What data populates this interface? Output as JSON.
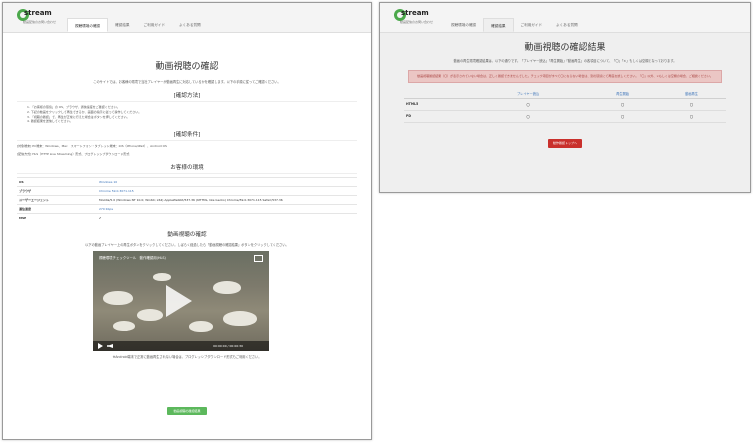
{
  "brand": {
    "logo_text": "stream",
    "logo_sub": "動画配信のお問い合わせ"
  },
  "nav": {
    "tabs": [
      "視聴環境の確認",
      "確認結果",
      "ご利用ガイド",
      "よくある質問"
    ]
  },
  "left": {
    "page_title": "動画視聴の確認",
    "intro": "このサイトでは、お客様の環境で当社プレイヤーが動画再生に対応しているかを確認します。以下の手順に従ってご確認ください。",
    "section_method": "[確認方法]",
    "method_items": [
      "1. 「お客様の環境」の OS、ブラウザ、通信速度をご確認ください。",
      "2. 下記の動画をクリックして再生できるか、画面の指示に従って操作してください。",
      "3. 「視聴の確認」で、再生が正常に行えた場合はボタンを押してください。",
      "4. 確認結果を送信してください。"
    ],
    "section_cond": "[確認条件]",
    "cond_lines": [
      "[対象端末] PC端末：Windows、Mac　スマートフォン・タブレット端末：iOS（iPhone/iPad）、Android OS",
      "[配信方式] HLS（HTTP Live Streaming）形式、プログレッシブダウンロード形式"
    ],
    "section_env": "お客様の環境",
    "env": [
      {
        "k": "OS",
        "v": "Windows 10"
      },
      {
        "k": "ブラウザ",
        "v": "Chrome 59.0.3071.115"
      },
      {
        "k": "ユーザーエージェント",
        "v": "Mozilla/5.0 (Windows NT 10.0; Win64; x64) AppleWebKit/537.36 (KHTML, like Gecko) Chrome/59.0.3071.115 Safari/537.36"
      },
      {
        "k": "通信速度",
        "v": "270 Kbps"
      },
      {
        "k": "MSE",
        "v": "✔"
      }
    ],
    "section_video": "動画視聴の確認",
    "video_intro": "以下の動画プレイヤー上の再生ボタンをクリックしてください。しばらく経過したら「動画視聴の確認結果」ボタンをクリックしてください。",
    "video_title": "視聴環境チェックツール　動作確認用(HLS)",
    "video_time": "00:00:00 / 00:00:30",
    "note": "※Android端末で正常に動画再生されない場合は、プログレッシブダウンロード形式もご利用ください。",
    "btn_result": "動画視聴の確認結果"
  },
  "right": {
    "page_title": "動画視聴の確認結果",
    "intro": "動画の再生環境確認結果は、以下の通りです。「プレイヤー読込」「再生開始」「動画再生」の各項目について、「〇」「×」もしくは空欄となっております。",
    "alert": "動画視聴確認結果（〇）が表示されていない場合は、正しく確認できませんでした。チェック項目がすべて〇にならない場合は、別の環境にて再度お試しください。「〇」以外、×もしくは空欄の場合、ご相談ください。",
    "columns": [
      "",
      "プレイヤー読込",
      "再生開始",
      "動画再生"
    ],
    "rows": [
      {
        "k": "HTML5",
        "c": [
          "〇",
          "〇",
          "〇"
        ]
      },
      {
        "k": "PD",
        "c": [
          "〇",
          "〇",
          "〇"
        ]
      }
    ],
    "btn_back": "動作確認トップへ"
  }
}
